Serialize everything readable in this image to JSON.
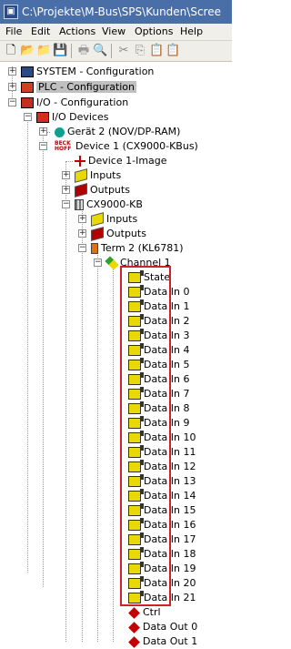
{
  "window": {
    "title": "C:\\Projekte\\M-Bus\\SPS\\Kunden\\Scree"
  },
  "menu": {
    "items": [
      "File",
      "Edit",
      "Actions",
      "View",
      "Options",
      "Help"
    ]
  },
  "toolbar": {
    "icons": [
      "new-icon",
      "open-icon",
      "save-folder-icon",
      "save-icon",
      "print-icon",
      "print-preview-icon",
      "cut-icon",
      "copy-icon",
      "paste-icon",
      "paste-special-icon"
    ]
  },
  "tree": {
    "system": "SYSTEM - Configuration",
    "plc": "PLC - Configuration",
    "io": "I/O - Configuration",
    "io_devices": "I/O Devices",
    "geraet2": "Gerät 2 (NOV/DP-RAM)",
    "device1": "Device 1 (CX9000-KBus)",
    "device1_image": "Device 1-Image",
    "inputs": "Inputs",
    "outputs": "Outputs",
    "cx9000": "CX9000-KB",
    "cx_inputs": "Inputs",
    "cx_outputs": "Outputs",
    "term2": "Term 2 (KL6781)",
    "channel1": "Channel 1",
    "inputs_list": [
      "State",
      "Data In 0",
      "Data In 1",
      "Data In 2",
      "Data In 3",
      "Data In 4",
      "Data In 5",
      "Data In 6",
      "Data In 7",
      "Data In 8",
      "Data In 9",
      "Data In 10",
      "Data In 11",
      "Data In 12",
      "Data In 13",
      "Data In 14",
      "Data In 15",
      "Data In 16",
      "Data In 17",
      "Data In 18",
      "Data In 19",
      "Data In 20",
      "Data In 21"
    ],
    "ctrl": "Ctrl",
    "data_out0": "Data Out 0",
    "data_out1": "Data Out 1",
    "beckhoff_logo": "BECK HOFF"
  },
  "colors": {
    "highlight_box": "#d0202c",
    "selection": "#c0c0c0"
  }
}
